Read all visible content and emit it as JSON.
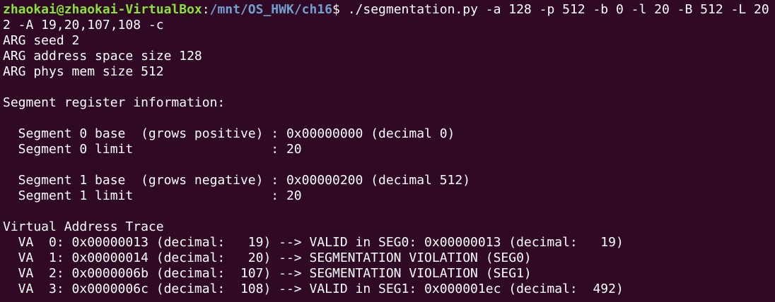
{
  "prompt": {
    "user_host": "zhaokai@zhaokai-VirtualBox",
    "separator": ":",
    "cwd": "/mnt/OS_HWK/ch16",
    "symbol": "$ ",
    "command": "./segmentation.py -a 128 -p 512 -b 0 -l 20 -B 512 -L 20",
    "command_wrap": "2 -A 19,20,107,108 -c"
  },
  "output": [
    "ARG seed 2",
    "ARG address space size 128",
    "ARG phys mem size 512",
    "",
    "Segment register information:",
    "",
    "  Segment 0 base  (grows positive) : 0x00000000 (decimal 0)",
    "  Segment 0 limit                  : 20",
    "",
    "  Segment 1 base  (grows negative) : 0x00000200 (decimal 512)",
    "  Segment 1 limit                  : 20",
    "",
    "Virtual Address Trace",
    "  VA  0: 0x00000013 (decimal:   19) --> VALID in SEG0: 0x00000013 (decimal:   19)",
    "  VA  1: 0x00000014 (decimal:   20) --> SEGMENTATION VIOLATION (SEG0)",
    "  VA  2: 0x0000006b (decimal:  107) --> SEGMENTATION VIOLATION (SEG1)",
    "  VA  3: 0x0000006c (decimal:  108) --> VALID in SEG1: 0x000001ec (decimal:  492)"
  ],
  "colors": {
    "background": "#300a24",
    "text": "#ffffff",
    "user_host": "#8ae234",
    "path": "#729fcf"
  }
}
